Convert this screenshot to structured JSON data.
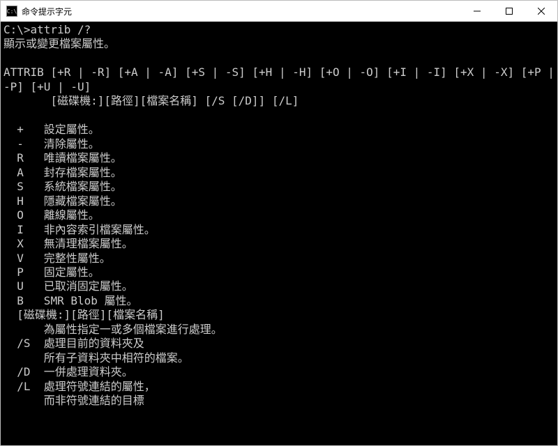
{
  "window": {
    "title": "命令提示字元",
    "app_icon_label": "C:\\"
  },
  "terminal": {
    "prompt": "C:\\>",
    "command": "attrib /?",
    "desc": "顯示或變更檔案屬性。",
    "usage1": "ATTRIB [+R | -R] [+A | -A] [+S | -S] [+H | -H] [+O | -O] [+I | -I] [+X | -X] [+P | -P] [+U | -U]",
    "usage2": "       [磁碟機:][路徑][檔案名稱] [/S [/D]] [/L]",
    "rows": [
      {
        "flag": "  +",
        "text": "   設定屬性。"
      },
      {
        "flag": "  -",
        "text": "   清除屬性。"
      },
      {
        "flag": "  R",
        "text": "   唯讀檔案屬性。"
      },
      {
        "flag": "  A",
        "text": "   封存檔案屬性。"
      },
      {
        "flag": "  S",
        "text": "   系統檔案屬性。"
      },
      {
        "flag": "  H",
        "text": "   隱藏檔案屬性。"
      },
      {
        "flag": "  O",
        "text": "   離線屬性。"
      },
      {
        "flag": "  I",
        "text": "   非內容索引檔案屬性。"
      },
      {
        "flag": "  X",
        "text": "   無清理檔案屬性。"
      },
      {
        "flag": "  V",
        "text": "   完整性屬性。"
      },
      {
        "flag": "  P",
        "text": "   固定屬性。"
      },
      {
        "flag": "  U",
        "text": "   已取消固定屬性。"
      },
      {
        "flag": "  B",
        "text": "   SMR Blob 屬性。"
      }
    ],
    "path_label": "  [磁碟機:][路徑][檔案名稱]",
    "path_desc": "      為屬性指定一或多個檔案進行處理。",
    "switches": [
      {
        "flag": "  /S",
        "text": "  處理目前的資料夾及"
      },
      {
        "flag": "    ",
        "text": "  所有子資料夾中相符的檔案。"
      },
      {
        "flag": "  /D",
        "text": "  一併處理資料夾。"
      },
      {
        "flag": "  /L",
        "text": "  處理符號連結的屬性，"
      },
      {
        "flag": "    ",
        "text": "  而非符號連結的目標"
      }
    ]
  }
}
